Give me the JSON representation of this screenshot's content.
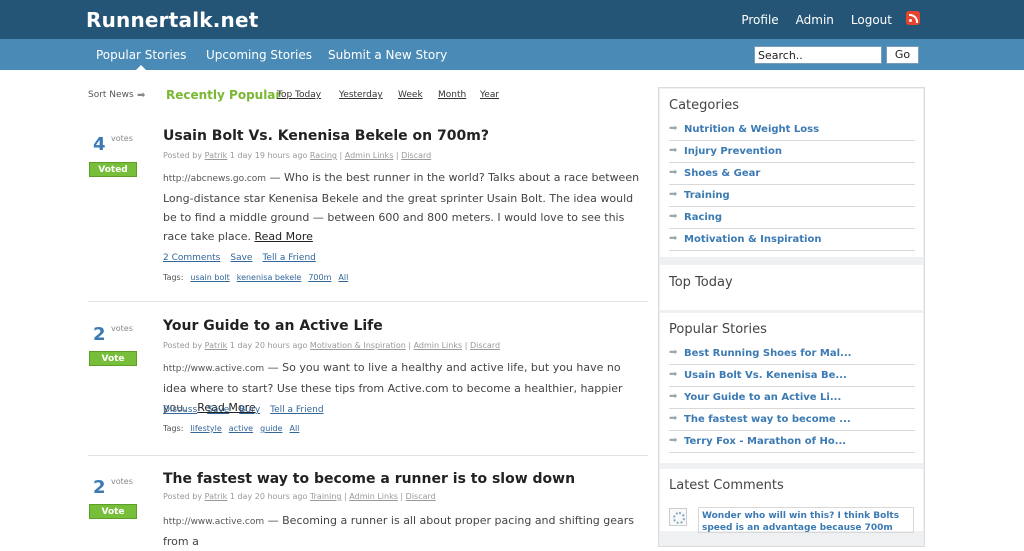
{
  "header": {
    "site_title": "Runnertalk.net",
    "links": [
      "Profile",
      "Admin",
      "Logout"
    ]
  },
  "nav": {
    "items": [
      "Popular Stories",
      "Upcoming Stories",
      "Submit a New Story"
    ],
    "active_index": 0,
    "search_placeholder": "Search..",
    "go_label": "Go"
  },
  "sort": {
    "label": "Sort News",
    "active": "Recently Popular",
    "links": [
      "Top Today",
      "Yesterday",
      "Week",
      "Month",
      "Year"
    ]
  },
  "stories": [
    {
      "votes": "4",
      "votes_label": "votes",
      "vote_button": "Voted",
      "title": "Usain Bolt Vs. Kenenisa Bekele on 700m?",
      "posted_prefix": "Posted by",
      "author": "Patrik",
      "time": "1 day 19 hours ago",
      "meta_links": [
        "Racing",
        "Admin Links",
        "Discard"
      ],
      "source": "http://abcnews.go.com",
      "text": "— Who is the best runner in the world? Talks about a race between Long-distance star Kenenisa Bekele and the great sprinter Usain Bolt. The idea would be to find a middle ground — between 600 and 800 meters. I would love to see this race take place.",
      "read_more": "Read More",
      "actions": [
        "2 Comments",
        "Save",
        "Tell a Friend"
      ],
      "tags_label": "Tags:",
      "tags": [
        "usain bolt",
        "kenenisa bekele",
        "700m",
        "All"
      ]
    },
    {
      "votes": "2",
      "votes_label": "votes",
      "vote_button": "Vote",
      "title": "Your Guide to an Active Life",
      "posted_prefix": "Posted by",
      "author": "Patrik",
      "time": "1 day 20 hours ago",
      "meta_links": [
        "Motivation & Inspiration",
        "Admin Links",
        "Discard"
      ],
      "source": "http://www.active.com",
      "text": "— So you want to live a healthy and active life, but you have no idea where to start? Use these tips from Active.com to become a healthier, happier you.",
      "read_more": "Read More",
      "actions": [
        "Discuss",
        "Save",
        "Bury",
        "Tell a Friend"
      ],
      "tags_label": "Tags:",
      "tags": [
        "lifestyle",
        "active",
        "guide",
        "All"
      ]
    },
    {
      "votes": "2",
      "votes_label": "votes",
      "vote_button": "Vote",
      "title": "The fastest way to become a runner is to slow down",
      "posted_prefix": "Posted by",
      "author": "Patrik",
      "time": "1 day 20 hours ago",
      "meta_links": [
        "Training",
        "Admin Links",
        "Discard"
      ],
      "source": "http://www.active.com",
      "text": "— Becoming a runner is all about proper pacing and shifting gears from a"
    }
  ],
  "sidebar": {
    "categories_title": "Categories",
    "categories": [
      "Nutrition & Weight Loss",
      "Injury Prevention",
      "Shoes & Gear",
      "Training",
      "Racing",
      "Motivation & Inspiration"
    ],
    "top_today_title": "Top Today",
    "popular_title": "Popular Stories",
    "popular": [
      "Best Running Shoes for Mal...",
      "Usain Bolt Vs. Kenenisa Be...",
      "Your Guide to an Active Li...",
      "The fastest way to become ...",
      "Terry Fox - Marathon of Ho..."
    ],
    "latest_comments_title": "Latest Comments",
    "latest_comment": "Wonder who will win this? I think Bolts speed is an advantage because 700m"
  },
  "colors": {
    "topbar": "#245576",
    "navbar": "#4a8ab6",
    "vote_green": "#77bf3a",
    "sort_active_green": "#7ab833",
    "link_blue": "#3b7ab3"
  }
}
